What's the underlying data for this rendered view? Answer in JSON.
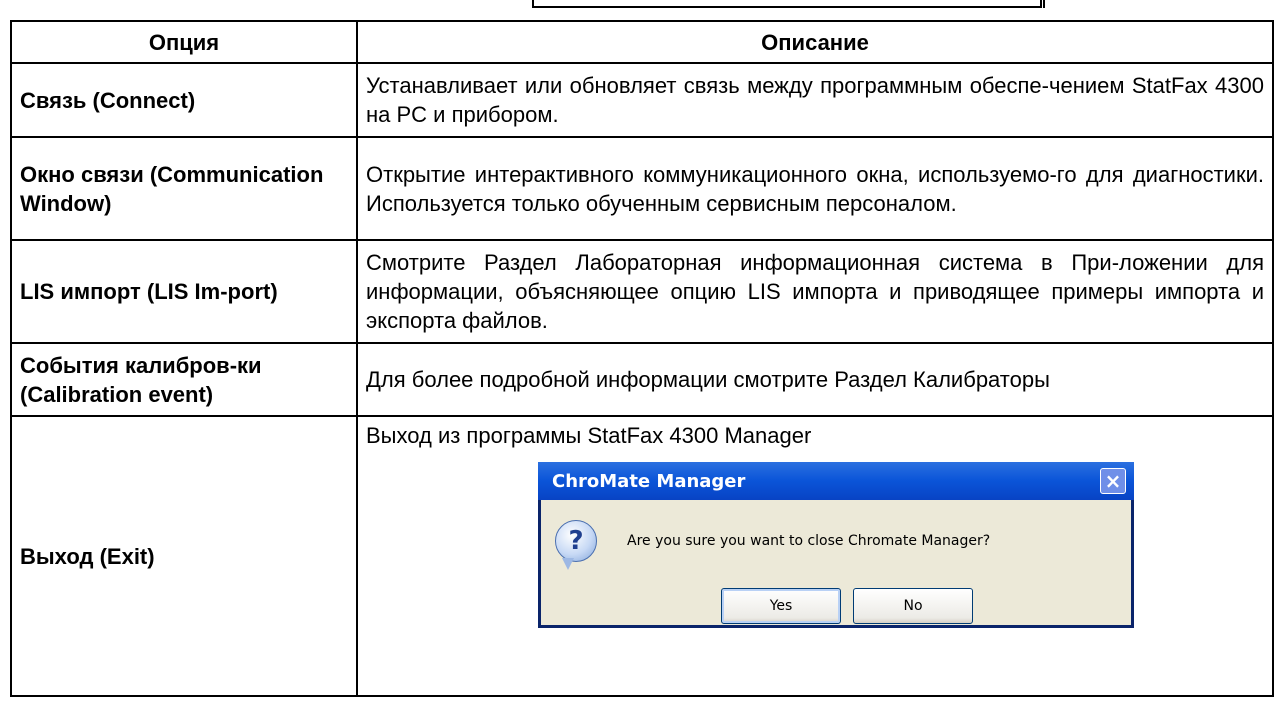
{
  "table": {
    "header": {
      "option": "Опция",
      "description": "Описание"
    },
    "rows": [
      {
        "option": "Связь (Connect)",
        "description": "Устанавливает или обновляет связь между программным обеспе-чением StatFax 4300 на PC и прибором."
      },
      {
        "option": "Окно связи (Communication Window)",
        "description": "Открытие интерактивного коммуникационного окна, используемо-го для диагностики. Используется только обученным сервисным персоналом."
      },
      {
        "option": "LIS импорт (LIS Im-port)",
        "description": "Смотрите Раздел Лабораторная информационная система в При-ложении для информации, объясняющее опцию LIS импорта и приводящее примеры импорта и экспорта файлов."
      },
      {
        "option": "События калибров-ки (Calibration event)",
        "description": "Для более подробной информации смотрите Раздел Калибраторы"
      },
      {
        "option": "Выход (Exit)",
        "description": "Выход из программы StatFax 4300 Manager"
      }
    ]
  },
  "dialog": {
    "title": "ChroMate Manager",
    "close_icon": "close-icon",
    "question_icon": "question-icon",
    "message": "Are you sure you want to close Chromate Manager?",
    "yes_label": "Yes",
    "no_label": "No"
  }
}
